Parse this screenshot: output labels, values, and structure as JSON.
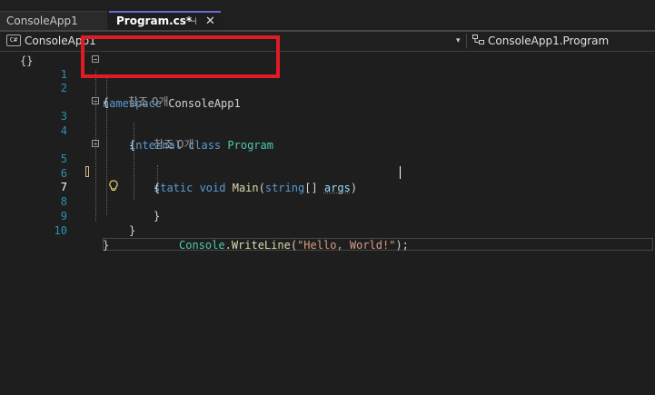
{
  "tabs": [
    {
      "label": "ConsoleApp1"
    },
    {
      "label": "Program.cs*",
      "pin_glyph": "⊣",
      "close_glyph": "✕"
    }
  ],
  "navbar": {
    "project": "ConsoleApp1",
    "lang_badge": "C#",
    "class_name": "ConsoleApp1.Program",
    "dropdown_glyph": "▾",
    "class_icon": "class-icon"
  },
  "editor": {
    "margin_icon": "{}",
    "current_line": 7,
    "lines": [
      {
        "n": "1",
        "fold": "−"
      },
      {
        "n": "2"
      },
      {
        "n": "",
        "ref": "참조 0개"
      },
      {
        "n": "3",
        "fold": "−"
      },
      {
        "n": "4"
      },
      {
        "n": "",
        "ref": "참조 0개"
      },
      {
        "n": "5",
        "fold": "−"
      },
      {
        "n": "6"
      },
      {
        "n": "7"
      },
      {
        "n": "8"
      },
      {
        "n": "9"
      },
      {
        "n": "10"
      }
    ],
    "tokens": {
      "l1_kw": "namespace",
      "l1_name": " ConsoleApp1",
      "brace_open": "{",
      "brace_close": "}",
      "l3_kw": "internal class",
      "l3_cls": "Program",
      "l5_kw1": "static void",
      "l5_m": "Main",
      "l5_p1": "(",
      "l5_kw2": "string",
      "l5_p2": "[] ",
      "l5_arg": "args",
      "l5_p3": ")",
      "l7_cls": "Console",
      "l7_dot": ".",
      "l7_m": "WriteLine",
      "l7_p1": "(",
      "l7_str": "\"Hello, World!\"",
      "l7_p2": ");"
    }
  },
  "colors": {
    "keyword": "#569cd6",
    "type": "#4ec9b0",
    "string": "#d69d85",
    "method": "#dcdcaa",
    "line_number": "#2b91af",
    "annotation_box": "#e01b24"
  }
}
